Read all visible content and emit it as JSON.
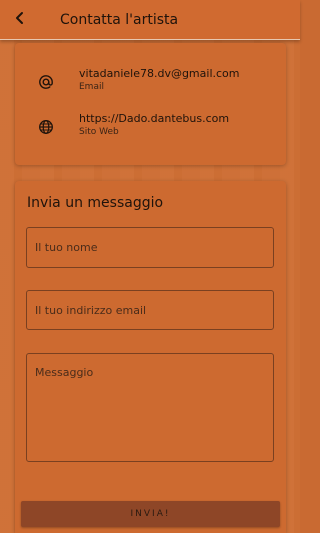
{
  "header": {
    "title": "Contatta l'artista",
    "back_icon": "arrow-left-icon"
  },
  "contacts": [
    {
      "icon": "at-sign-icon",
      "value": "vitadaniele78.dv@gmail.com",
      "label": "Email"
    },
    {
      "icon": "globe-icon",
      "value": "https://Dado.dantebus.com",
      "label": "Sito Web"
    }
  ],
  "form": {
    "title": "Invia un messaggio",
    "name_placeholder": "Il tuo nome",
    "email_placeholder": "Il tuo indirizzo email",
    "message_placeholder": "Messaggio",
    "send_label": "INVIA!"
  },
  "colors": {
    "accent": "#c96a32",
    "button": "#8e4627"
  }
}
